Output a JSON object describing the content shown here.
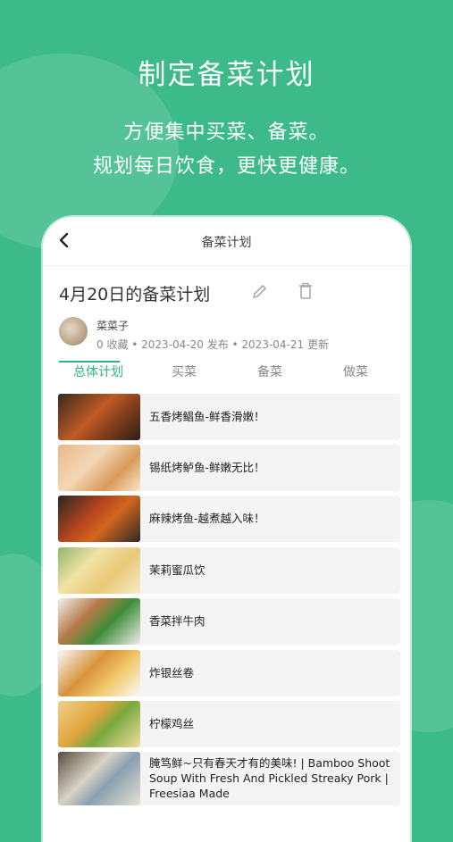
{
  "promo": {
    "title": "制定备菜计划",
    "line1": "方便集中买菜、备菜。",
    "line2": "规划每日饮食，更快更健康。"
  },
  "nav": {
    "title": "备菜计划",
    "back_icon": "chevron-left-icon"
  },
  "plan": {
    "title": "4月20日的备菜计划",
    "author": "菜菜子",
    "meta": "0 收藏 • 2023-04-20 发布 • 2023-04-21 更新"
  },
  "tabs": [
    {
      "label": "总体计划",
      "active": true
    },
    {
      "label": "买菜",
      "active": false
    },
    {
      "label": "备菜",
      "active": false
    },
    {
      "label": "做菜",
      "active": false
    }
  ],
  "recipes": [
    {
      "label": "五香烤鲳鱼-鲜香滑嫩！"
    },
    {
      "label": "锡纸烤鲈鱼-鲜嫩无比！"
    },
    {
      "label": "麻辣烤鱼-越煮越入味！"
    },
    {
      "label": "茉莉蜜瓜饮"
    },
    {
      "label": "香菜拌牛肉"
    },
    {
      "label": "炸银丝卷"
    },
    {
      "label": "柠檬鸡丝"
    },
    {
      "label": "腌笃鲜~只有春天才有的美味! | Bamboo Shoot Soup With Fresh And Pickled Streaky Pork | Freesiaa Made"
    }
  ],
  "colors": {
    "accent": "#2fb483",
    "background": "#3dba8a"
  }
}
